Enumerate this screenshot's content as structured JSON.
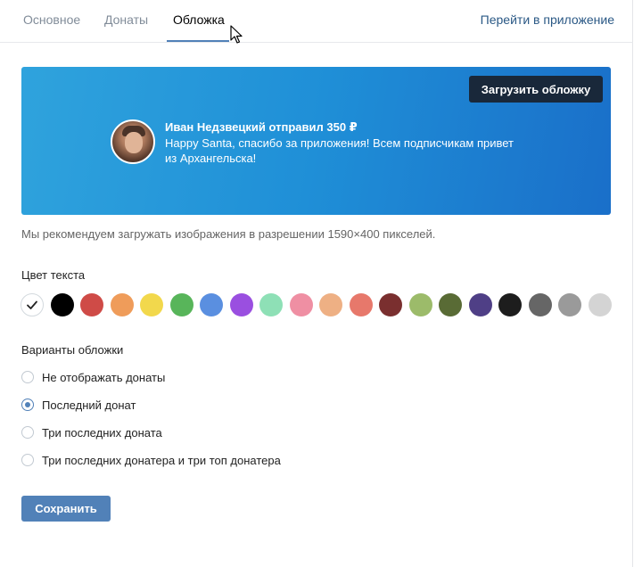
{
  "tabs": [
    {
      "label": "Основное"
    },
    {
      "label": "Донаты"
    },
    {
      "label": "Обложка"
    }
  ],
  "header": {
    "app_link": "Перейти в приложение"
  },
  "banner": {
    "upload_button": "Загрузить обложку",
    "donor_line": "Иван Недзвецкий отправил 350 ₽",
    "message": "Happy Santa, спасибо за приложения! Всем подписчикам привет из Архангельска!"
  },
  "hint": "Мы рекомендуем загружать изображения в разрешении 1590×400 пикселей.",
  "text_color": {
    "title": "Цвет текста",
    "selected_index": 0,
    "swatches": [
      "#ffffff",
      "#000000",
      "#cf4b47",
      "#ef9c5a",
      "#f2d84c",
      "#58b55a",
      "#5a8fe0",
      "#9a4fe0",
      "#8ee0b6",
      "#ef8fa3",
      "#eeb084",
      "#e7786b",
      "#7a2f2f",
      "#9cbb6a",
      "#596b35",
      "#4f3f86",
      "#1d1d1d",
      "#666666",
      "#9a9a9a",
      "#d4d4d4"
    ]
  },
  "cover_options": {
    "title": "Варианты обложки",
    "selected_index": 1,
    "items": [
      {
        "label": "Не отображать донаты"
      },
      {
        "label": "Последний донат"
      },
      {
        "label": "Три последних доната"
      },
      {
        "label": "Три последних донатера и три топ донатера"
      }
    ]
  },
  "save_button": "Сохранить"
}
